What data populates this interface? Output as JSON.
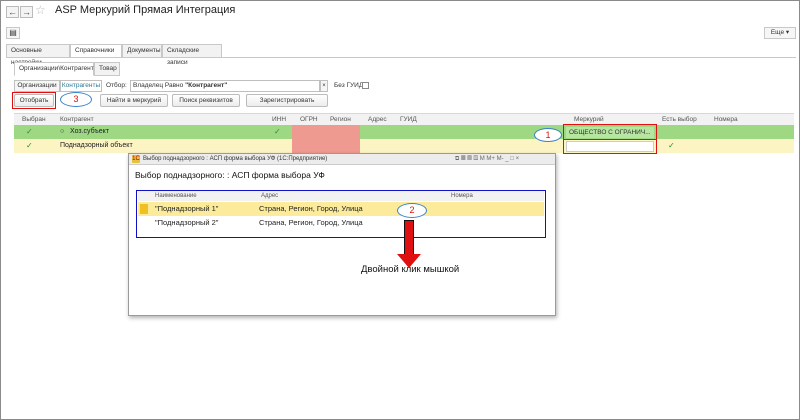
{
  "window": {
    "back_icon": "arrow-left-icon",
    "forward_icon": "arrow-right-icon",
    "favorite_icon": "star-icon",
    "title": "ASP Меркурий Прямая Интеграция",
    "more_label": "Еще"
  },
  "main_tabs": [
    "Основные настройки",
    "Справочники",
    "Документы",
    "Складские записи"
  ],
  "sub_tabs": [
    "Организации\\Контрагенты",
    "Товар"
  ],
  "filter": {
    "segments": [
      "Организации",
      "Контрагенты"
    ],
    "label": "Отбор",
    "value_prefix": "Владелец Равно ",
    "value_bold": "\"Контрагент\"",
    "no_guid_label": "Без ГУИД"
  },
  "buttons": {
    "select": "Отобрать",
    "find": "Найти в меркурий",
    "search_req": "Поиск реквизитов",
    "register": "Зарегистрировать"
  },
  "columns": [
    "Выбран",
    "Контрагент",
    "ИНН",
    "ОГРН",
    "Регион",
    "Адрес",
    "ГУИД",
    "Меркурий",
    "Есть выбор",
    "Номера"
  ],
  "rows": [
    {
      "name": "Хоз.субъект",
      "inn_check": "✓",
      "mercury": "ОБЩЕСТВО С ОГРАНИЧ...",
      "selected_check": "✓",
      "has_choice_check": ""
    },
    {
      "name": "Поднадзорный объект",
      "inn_check": "",
      "mercury": "",
      "selected_check": "✓",
      "has_choice_check": "✓"
    }
  ],
  "dialog": {
    "title": "Выбор поднадзорного : АСП форма выбора УФ (1С:Предприятие)",
    "heading": "Выбор поднадзорного: : АСП форма выбора УФ",
    "columns": [
      "Наименование",
      "Адрес",
      "Номера"
    ],
    "rows": [
      {
        "name": "\"Поднадзорный 1\"",
        "address": "Страна, Регион, Город, Улица"
      },
      {
        "name": "\"Поднадзорный 2\"",
        "address": "Страна, Регион, Город, Улица"
      }
    ],
    "ctrl_labels": [
      "M",
      "M+",
      "M-"
    ]
  },
  "annotation": {
    "text": "Двойной клик мышкой",
    "callouts": [
      "1",
      "2",
      "3"
    ]
  },
  "colors": {
    "highlight_green": "#9ed882",
    "highlight_yellow": "#fdf4c4",
    "ogrn_red": "#ef9a90",
    "annotation_red": "#e01010",
    "annotation_blue": "#1010c8"
  }
}
